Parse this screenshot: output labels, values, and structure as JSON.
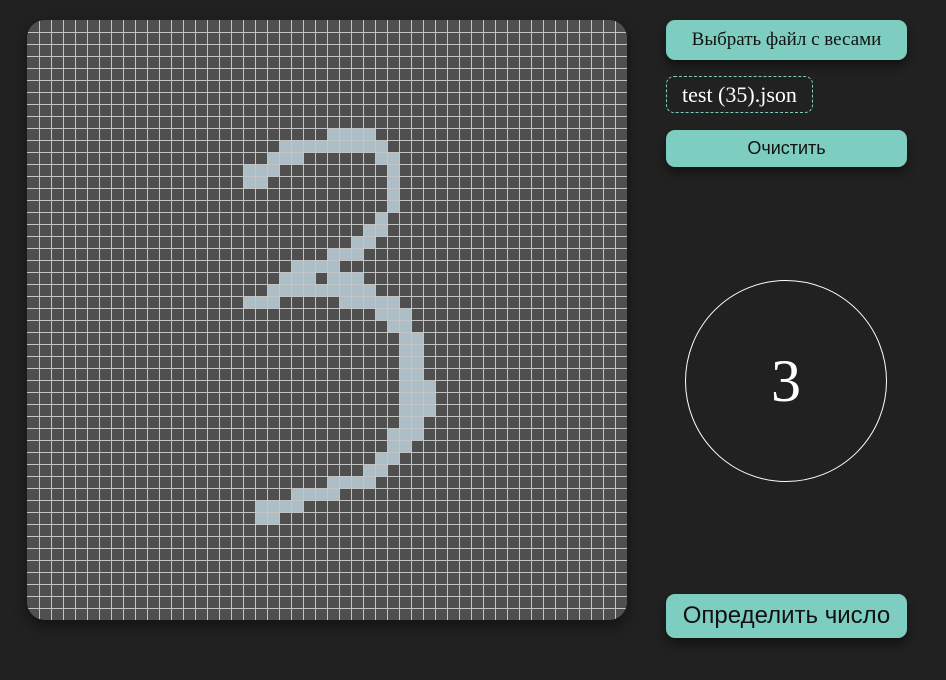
{
  "controls": {
    "choose_weights_label": "Выбрать файл с весами",
    "file_name": "test (35).json",
    "clear_label": "Очистить",
    "predict_label": "Определить число"
  },
  "result": {
    "digit": "3"
  },
  "canvas": {
    "grid_cols": 50,
    "grid_rows": 50,
    "background_color": "#4f4f4f",
    "grid_line_color": "#c4c4c4",
    "ink_color": "#aebec6",
    "ink_rows": [
      {
        "row": 9,
        "spans": [
          [
            25,
            28
          ]
        ]
      },
      {
        "row": 10,
        "spans": [
          [
            21,
            29
          ]
        ]
      },
      {
        "row": 11,
        "spans": [
          [
            20,
            22
          ],
          [
            29,
            30
          ]
        ]
      },
      {
        "row": 12,
        "spans": [
          [
            18,
            20
          ],
          [
            30,
            30
          ]
        ]
      },
      {
        "row": 13,
        "spans": [
          [
            18,
            19
          ],
          [
            30,
            30
          ]
        ]
      },
      {
        "row": 14,
        "spans": [
          [
            30,
            30
          ]
        ]
      },
      {
        "row": 15,
        "spans": [
          [
            30,
            30
          ]
        ]
      },
      {
        "row": 16,
        "spans": [
          [
            29,
            29
          ]
        ]
      },
      {
        "row": 17,
        "spans": [
          [
            28,
            29
          ]
        ]
      },
      {
        "row": 18,
        "spans": [
          [
            27,
            28
          ]
        ]
      },
      {
        "row": 19,
        "spans": [
          [
            25,
            27
          ]
        ]
      },
      {
        "row": 20,
        "spans": [
          [
            22,
            25
          ]
        ]
      },
      {
        "row": 21,
        "spans": [
          [
            21,
            23
          ],
          [
            25,
            27
          ]
        ]
      },
      {
        "row": 22,
        "spans": [
          [
            20,
            28
          ]
        ]
      },
      {
        "row": 23,
        "spans": [
          [
            18,
            20
          ],
          [
            26,
            30
          ]
        ]
      },
      {
        "row": 24,
        "spans": [
          [
            29,
            31
          ]
        ]
      },
      {
        "row": 25,
        "spans": [
          [
            30,
            31
          ]
        ]
      },
      {
        "row": 26,
        "spans": [
          [
            31,
            32
          ]
        ]
      },
      {
        "row": 27,
        "spans": [
          [
            31,
            32
          ]
        ]
      },
      {
        "row": 28,
        "spans": [
          [
            31,
            32
          ]
        ]
      },
      {
        "row": 29,
        "spans": [
          [
            31,
            32
          ]
        ]
      },
      {
        "row": 30,
        "spans": [
          [
            31,
            33
          ]
        ]
      },
      {
        "row": 31,
        "spans": [
          [
            31,
            33
          ]
        ]
      },
      {
        "row": 32,
        "spans": [
          [
            31,
            33
          ]
        ]
      },
      {
        "row": 33,
        "spans": [
          [
            31,
            32
          ]
        ]
      },
      {
        "row": 34,
        "spans": [
          [
            30,
            32
          ]
        ]
      },
      {
        "row": 35,
        "spans": [
          [
            30,
            31
          ]
        ]
      },
      {
        "row": 36,
        "spans": [
          [
            29,
            30
          ]
        ]
      },
      {
        "row": 37,
        "spans": [
          [
            28,
            29
          ]
        ]
      },
      {
        "row": 38,
        "spans": [
          [
            25,
            28
          ]
        ]
      },
      {
        "row": 39,
        "spans": [
          [
            22,
            25
          ]
        ]
      },
      {
        "row": 40,
        "spans": [
          [
            19,
            22
          ]
        ]
      },
      {
        "row": 41,
        "spans": [
          [
            19,
            20
          ]
        ]
      }
    ]
  }
}
